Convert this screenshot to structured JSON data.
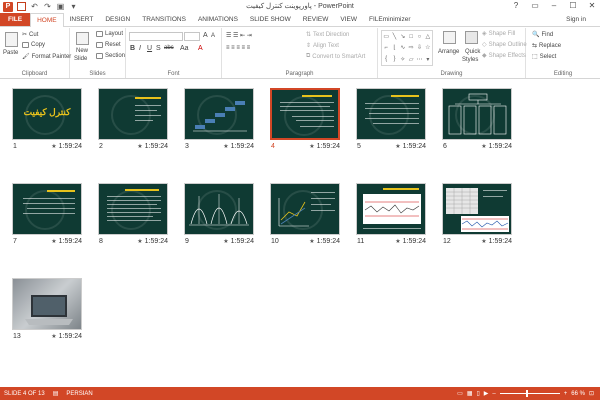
{
  "window": {
    "title": "پاورپوینت کنترل کیفیت - PowerPoint",
    "controls": [
      "?",
      "▭",
      "–",
      "☐",
      "✕"
    ]
  },
  "tabs": [
    "FILE",
    "HOME",
    "INSERT",
    "DESIGN",
    "TRANSITIONS",
    "ANIMATIONS",
    "SLIDE SHOW",
    "REVIEW",
    "VIEW",
    "FILEminimizer"
  ],
  "active_tab": "HOME",
  "signin": "Sign in",
  "ribbon": {
    "clipboard": {
      "label": "Clipboard",
      "paste": "Paste",
      "cut": "Cut",
      "copy": "Copy",
      "format_painter": "Format Painter"
    },
    "slides": {
      "label": "Slides",
      "new_slide": "New",
      "new_slide_2": "Slide",
      "layout": "Layout",
      "reset": "Reset",
      "section": "Section"
    },
    "font": {
      "label": "Font",
      "bold": "B",
      "italic": "I",
      "underline": "U",
      "shadow": "S",
      "strike": "abc",
      "aa": "Aa",
      "grow": "A",
      "shrink": "A"
    },
    "paragraph": {
      "label": "Paragraph",
      "text_direction": "Text Direction",
      "align_text": "Align Text",
      "convert_smartart": "Convert to SmartArt"
    },
    "drawing": {
      "label": "Drawing",
      "arrange": "Arrange",
      "quick_styles": "Quick",
      "quick_styles_2": "Styles",
      "shape_fill": "Shape Fill",
      "shape_outline": "Shape Outline",
      "shape_effects": "Shape Effects"
    },
    "editing": {
      "label": "Editing",
      "find": "Find",
      "replace": "Replace",
      "select": "Select"
    }
  },
  "slides": [
    {
      "num": "1",
      "time": "1:59:24",
      "title": "کنترل کیفیت"
    },
    {
      "num": "2",
      "time": "1:59:24"
    },
    {
      "num": "3",
      "time": "1:59:24"
    },
    {
      "num": "4",
      "time": "1:59:24",
      "selected": true
    },
    {
      "num": "5",
      "time": "1:59:24"
    },
    {
      "num": "6",
      "time": "1:59:24"
    },
    {
      "num": "7",
      "time": "1:59:24"
    },
    {
      "num": "8",
      "time": "1:59:24"
    },
    {
      "num": "9",
      "time": "1:59:24"
    },
    {
      "num": "10",
      "time": "1:59:24"
    },
    {
      "num": "11",
      "time": "1:59:24"
    },
    {
      "num": "12",
      "time": "1:59:24"
    },
    {
      "num": "13",
      "time": "1:59:24"
    }
  ],
  "status": {
    "slide_info": "SLIDE 4 OF 13",
    "language": "PERSIAN",
    "zoom": "66 %",
    "zoom_level": 0.66
  },
  "colors": {
    "accent": "#d24726",
    "slide_bg": "#0f3a33",
    "title_yellow": "#e8c21c"
  }
}
